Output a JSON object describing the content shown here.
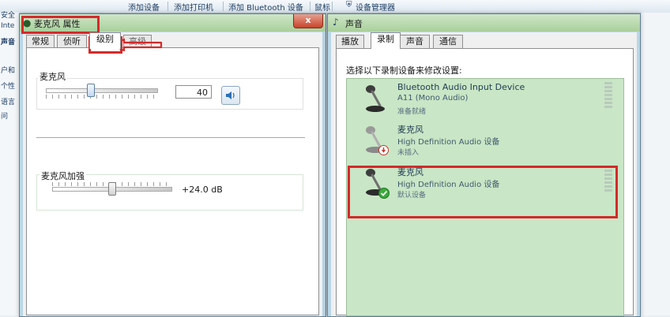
{
  "background": {
    "toolbar": [
      "添加设备",
      "添加打印机",
      "添加 Bluetooth 设备",
      "鼠标",
      "设备管理器"
    ],
    "left_nav": [
      "安全",
      "Inte",
      "声音",
      "户和",
      "个性",
      "语言",
      "问"
    ]
  },
  "mic_dialog": {
    "title": "麦克风 属性",
    "close": "x",
    "tabs": [
      "常规",
      "侦听",
      "级别",
      "高级"
    ],
    "active_tab": 2,
    "microphone": {
      "label": "麦克风",
      "value": "40",
      "level": 0.4
    },
    "boost": {
      "label": "麦克风加强",
      "value": "+24.0 dB",
      "level": 0.5
    }
  },
  "sound_dialog": {
    "title": "声音",
    "tabs": [
      "播放",
      "录制",
      "声音",
      "通信"
    ],
    "active_tab": 1,
    "instruction": "选择以下录制设备来修改设置:",
    "devices": [
      {
        "name": "Bluetooth Audio Input Device",
        "desc": "A11 (Mono Audio)",
        "status": "准备就绪",
        "selected": false,
        "badge": "none"
      },
      {
        "name": "麦克风",
        "desc": "High Definition Audio 设备",
        "status": "未插入",
        "selected": false,
        "badge": "unplugged"
      },
      {
        "name": "麦克风",
        "desc": "High Definition Audio 设备",
        "status": "默认设备",
        "selected": true,
        "badge": "default"
      }
    ]
  },
  "colors": {
    "list_bg": "#c9e6c6",
    "highlight": "#d42a2a",
    "default_check": "#3caa3c",
    "unplugged": "#c0392b"
  }
}
